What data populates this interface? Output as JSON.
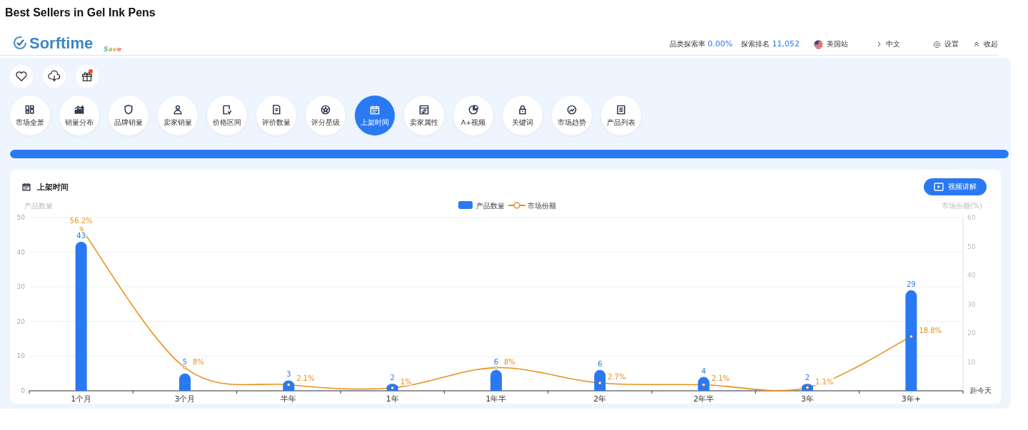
{
  "page_title": "Best Sellers in Gel Ink Pens",
  "logo": {
    "name": "Sorftime",
    "badge": "Save"
  },
  "header_stats": [
    {
      "label": "品类探索率",
      "value": "0.00%"
    },
    {
      "label": "探索排名",
      "value": "11,052"
    }
  ],
  "header_links": [
    {
      "kind": "site",
      "label": "美国站"
    },
    {
      "kind": "lang",
      "label": "中文"
    },
    {
      "kind": "settings",
      "label": "设置"
    },
    {
      "kind": "collapse",
      "label": "收起"
    }
  ],
  "quick_actions": [
    {
      "kind": "favorite",
      "badge": false
    },
    {
      "kind": "download",
      "badge": false
    },
    {
      "kind": "gift",
      "badge": true
    }
  ],
  "nav": [
    {
      "label": "市场全景",
      "selected": false
    },
    {
      "label": "销量分布",
      "selected": false
    },
    {
      "label": "品牌销量",
      "selected": false
    },
    {
      "label": "卖家销量",
      "selected": false
    },
    {
      "label": "价格区间",
      "selected": false
    },
    {
      "label": "评价数量",
      "selected": false
    },
    {
      "label": "评分星级",
      "selected": false
    },
    {
      "label": "上架时间",
      "selected": true
    },
    {
      "label": "卖家属性",
      "selected": false
    },
    {
      "label": "A+视频",
      "selected": false
    },
    {
      "label": "关键词",
      "selected": false
    },
    {
      "label": "市场趋势",
      "selected": false
    },
    {
      "label": "产品列表",
      "selected": false
    }
  ],
  "progress": {
    "level": 1
  },
  "panel": {
    "title": "上架时间",
    "video_button": "视频讲解",
    "chart_data": {
      "type": "bar",
      "xlabel": "距今天",
      "ylabel": "产品数量",
      "y2label": "市场份额(%)",
      "categories": [
        "1个月",
        "3个月",
        "半年",
        "1年",
        "1年半",
        "2年",
        "2年半",
        "3年",
        "3年+"
      ],
      "series": [
        {
          "name": "产品数量",
          "type": "bar",
          "color": "#2979f2",
          "values": [
            43,
            5,
            3,
            2,
            6,
            6,
            4,
            2,
            29
          ],
          "value_labels": [
            "43",
            "5",
            "3",
            "2",
            "6",
            "6",
            "4",
            "2",
            "29"
          ]
        },
        {
          "name": "市场份额",
          "type": "line",
          "color": "#e8901c",
          "axis": "y2",
          "marker": true,
          "values": [
            56.2,
            8,
            2.1,
            1,
            8,
            2.7,
            2.1,
            1.1,
            18.8
          ],
          "value_labels": [
            "56.2%",
            "8%",
            "2.1%",
            "1%",
            "8%",
            "2.7%",
            "2.1%",
            "1.1%",
            "18.8%"
          ]
        }
      ],
      "ylim": [
        0,
        50
      ],
      "yticks": [
        0,
        10,
        20,
        30,
        40,
        50
      ],
      "y2lim": [
        0,
        60
      ],
      "y2ticks": [
        10,
        20,
        30,
        40,
        50,
        60
      ],
      "grid": true,
      "legend": "top"
    }
  }
}
